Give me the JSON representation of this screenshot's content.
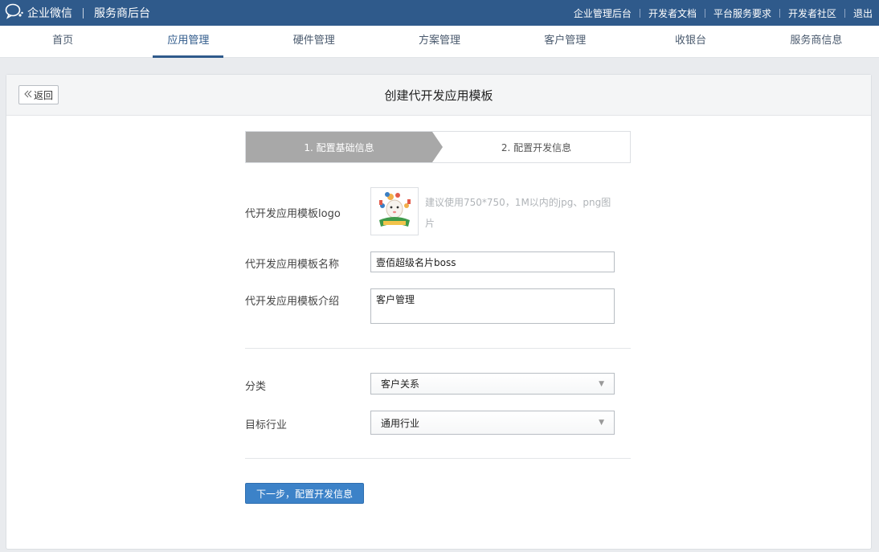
{
  "header": {
    "brand_name": "企业微信",
    "brand_sub": "服务商后台",
    "links": [
      "企业管理后台",
      "开发者文档",
      "平台服务要求",
      "开发者社区",
      "退出"
    ]
  },
  "nav": {
    "tabs": [
      "首页",
      "应用管理",
      "硬件管理",
      "方案管理",
      "客户管理",
      "收银台",
      "服务商信息"
    ],
    "active": "应用管理"
  },
  "page": {
    "back_label": "返回",
    "title": "创建代开发应用模板"
  },
  "steps": {
    "step1": "1. 配置基础信息",
    "step2": "2. 配置开发信息"
  },
  "form": {
    "logo_label": "代开发应用模板logo",
    "logo_hint": "建议使用750*750，1M以内的jpg、png图片",
    "name_label": "代开发应用模板名称",
    "name_value": "壹佰超级名片boss",
    "intro_label": "代开发应用模板介绍",
    "intro_value": "客户管理",
    "category_label": "分类",
    "category_value": "客户关系",
    "industry_label": "目标行业",
    "industry_value": "通用行业",
    "next_button": "下一步，配置开发信息"
  },
  "colors": {
    "header_bg": "#2f5a8b",
    "primary": "#3c82c8",
    "step_active": "#a8a8a8"
  }
}
